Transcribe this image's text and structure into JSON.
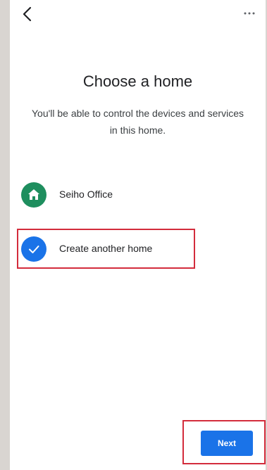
{
  "header": {
    "back_icon": "chevron-left-icon",
    "more_icon": "more-horizontal-icon"
  },
  "main": {
    "title": "Choose a home",
    "subtitle": "You'll be able to control the devices and services in this home."
  },
  "homes": [
    {
      "label": "Seiho Office",
      "icon": "home-icon",
      "icon_color": "#1e8e5e",
      "selected": false
    },
    {
      "label": "Create another home",
      "icon": "check-icon",
      "icon_color": "#1a73e8",
      "selected": true
    }
  ],
  "footer": {
    "next_label": "Next"
  },
  "colors": {
    "accent": "#1a73e8",
    "home_green": "#1e8e5e",
    "highlight_red": "#d32c3c"
  }
}
